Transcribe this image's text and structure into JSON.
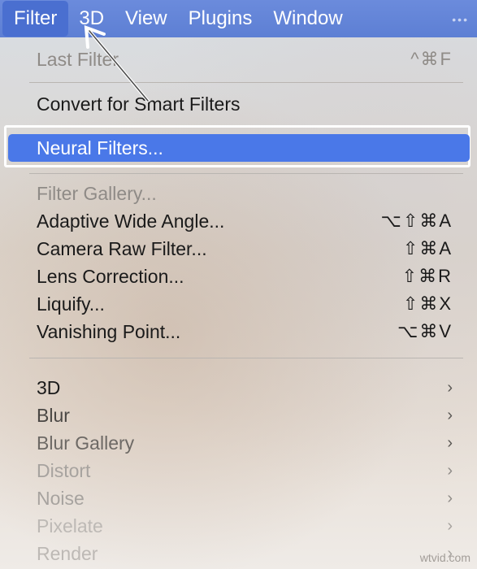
{
  "menubar": {
    "items": [
      {
        "label": "Filter",
        "active": true
      },
      {
        "label": "3D"
      },
      {
        "label": "View"
      },
      {
        "label": "Plugins"
      },
      {
        "label": "Window"
      }
    ],
    "overflow": "•••"
  },
  "menu": {
    "last_filter": {
      "label": "Last Filter",
      "shortcut": "^⌘F"
    },
    "convert_smart": {
      "label": "Convert for Smart Filters"
    },
    "neural_filters": {
      "label": "Neural Filters..."
    },
    "filter_gallery": {
      "label": "Filter Gallery..."
    },
    "adaptive_wide": {
      "label": "Adaptive Wide Angle...",
      "shortcut": "⌥⇧⌘A"
    },
    "camera_raw": {
      "label": "Camera Raw Filter...",
      "shortcut": "⇧⌘A"
    },
    "lens_correction": {
      "label": "Lens Correction...",
      "shortcut": "⇧⌘R"
    },
    "liquify": {
      "label": "Liquify...",
      "shortcut": "⇧⌘X"
    },
    "vanishing_point": {
      "label": "Vanishing Point...",
      "shortcut": "⌥⌘V"
    },
    "submenus": [
      {
        "label": "3D"
      },
      {
        "label": "Blur"
      },
      {
        "label": "Blur Gallery"
      },
      {
        "label": "Distort"
      },
      {
        "label": "Noise"
      },
      {
        "label": "Pixelate"
      },
      {
        "label": "Render"
      }
    ],
    "chevron": "›"
  },
  "colors": {
    "menubar": "#5d7fd4",
    "selection": "#4a78e8"
  },
  "watermark": "wtvid.com"
}
